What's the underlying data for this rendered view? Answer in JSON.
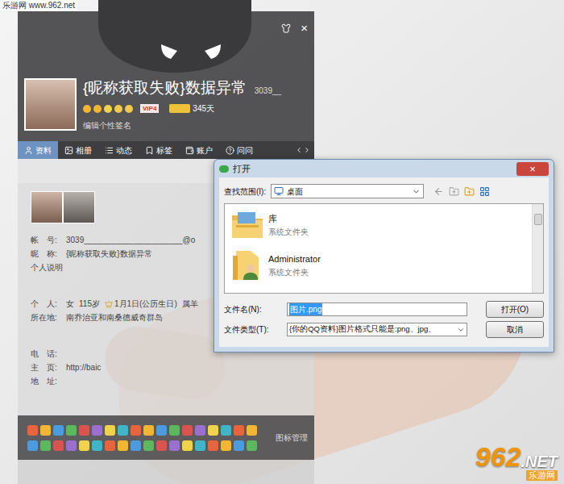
{
  "watermark": "乐游网 www.962.net",
  "logo": {
    "number": "962",
    "suffix": ".NET",
    "name": "乐游网"
  },
  "profile": {
    "close": "×",
    "nickname": "{昵称获取失败}数据异常",
    "qq_number": "3039__",
    "vip": "VIP4",
    "days": "345天",
    "signature": "编辑个性签名",
    "tabs": [
      {
        "label": "资料",
        "selected": true
      },
      {
        "label": "相册",
        "selected": false
      },
      {
        "label": "动态",
        "selected": false
      },
      {
        "label": "标签",
        "selected": false
      },
      {
        "label": "账户",
        "selected": false
      },
      {
        "label": "问问",
        "selected": false
      }
    ],
    "sections": [
      [
        {
          "label": "帐　号:",
          "values": [
            "3039______________________@o"
          ]
        },
        {
          "label": "昵　称:",
          "values": [
            "{昵称获取失败}数据异常"
          ]
        },
        {
          "label": "个人说明",
          "values": []
        }
      ],
      [
        {
          "label": "个　人:",
          "values": [
            "女",
            "115岁",
            "1月1日(公历生日)",
            "属羊"
          ]
        },
        {
          "label": "所在地:",
          "values": [
            "南乔治亚和南桑德威奇群岛"
          ]
        }
      ],
      [
        {
          "label": "电　话:",
          "values": []
        },
        {
          "label": "主　页:",
          "values": [
            "http://baic"
          ]
        },
        {
          "label": "地　址:",
          "values": []
        }
      ]
    ],
    "icon_manage": "图标管理"
  },
  "dialog": {
    "title": "打开",
    "close": "×",
    "look_in_label": "查找范围(I):",
    "look_in": "桌面",
    "items": [
      {
        "name": "库",
        "type": "系统文件夹",
        "kind": "library"
      },
      {
        "name": "Administrator",
        "type": "系统文件夹",
        "kind": "user"
      }
    ],
    "file_name_label": "文件名(N):",
    "file_name": "图片.png",
    "file_type_label": "文件类型(T):",
    "file_type": "{你的QQ资料}图片格式只能是:png、jpg、",
    "open_button": "打开(O)",
    "cancel_button": "取消"
  }
}
